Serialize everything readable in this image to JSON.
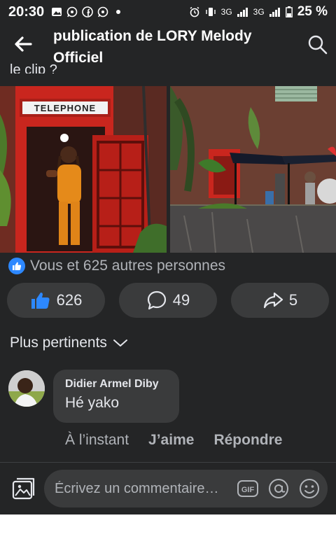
{
  "status_bar": {
    "time": "20:30",
    "battery": "25 %",
    "network_1": "3G",
    "network_2": "3G",
    "left_icons": [
      "gallery-icon",
      "whatsapp-icon",
      "facebook-icon",
      "whatsapp-icon",
      "dot-icon"
    ],
    "right_icons": [
      "alarm-icon",
      "vibrate-icon",
      "signal-icon",
      "signal-icon",
      "battery-icon"
    ]
  },
  "header": {
    "title": "publication de LORY Melody Officiel"
  },
  "post": {
    "partial_text": "le clip ?"
  },
  "reactions": {
    "summary": "Vous et 625 autres personnes"
  },
  "actions": {
    "like_count": "626",
    "comment_count": "49",
    "share_count": "5"
  },
  "sort": {
    "label": "Plus pertinents"
  },
  "comment": {
    "author": "Didier Armel Diby",
    "text": "Hé yako",
    "time": "À l’instant",
    "like_label": "J’aime",
    "reply_label": "Répondre"
  },
  "composer": {
    "placeholder": "Écrivez un commentaire…",
    "gif_label": "GIF"
  },
  "colors": {
    "background": "#242526",
    "surface": "#3a3b3c",
    "accent": "#2d88ff",
    "text": "#e4e6eb",
    "muted": "#b0b3b8"
  }
}
